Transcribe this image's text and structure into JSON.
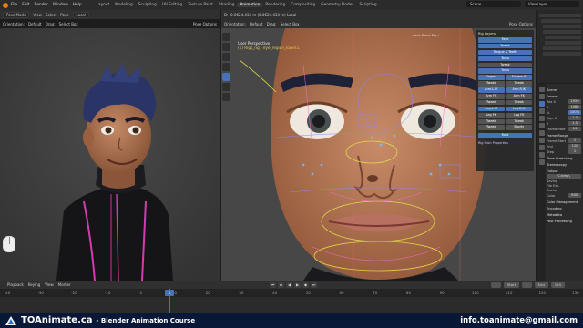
{
  "menu": {
    "items": [
      "File",
      "Edit",
      "Render",
      "Window",
      "Help"
    ],
    "workspaces": [
      "Layout",
      "Modeling",
      "Sculpting",
      "UV Editing",
      "Texture Paint",
      "Shading",
      "Animation",
      "Rendering",
      "Compositing",
      "Geometry Nodes",
      "Scripting"
    ],
    "active_workspace": "Animation",
    "scene_label": "Scene",
    "view_layer_label": "ViewLayer"
  },
  "left_header": {
    "mode": "Pose Mode",
    "view": "View",
    "select": "Select",
    "pose": "Pose",
    "transform": "Local",
    "orientation_label": "Orientation:",
    "orientation": "Default",
    "drag_label": "Drag:",
    "drag": "Select Box",
    "options": "Pose Options"
  },
  "right_header": {
    "info": "D: -0.0624.434 m (0.0624.434 m) Local",
    "orientation_label": "Orientation:",
    "orientation": "Default",
    "drag_label": "Drag:",
    "drag": "Select Box",
    "options": "Pose Options"
  },
  "viewport_overlay": {
    "line1": "User Perspective",
    "line2": "(1) Rigs_rig : eye_region_lower.L",
    "bone_label": "neck Plane.Rig.L"
  },
  "rig_panel": {
    "title": "Rig Layers",
    "buttons": [
      {
        "label": "Face",
        "on": true
      },
      {
        "label": "Tweak",
        "on": true
      },
      {
        "label": "Tongue & Teeth",
        "on": true
      },
      {
        "label": "Torso",
        "on": true
      },
      {
        "label": "Tweak",
        "on": false
      },
      {
        "label": "Torso",
        "on": true
      }
    ],
    "rows": [
      [
        {
          "label": "Fingers",
          "on": true
        },
        {
          "label": "Fingers R",
          "on": true
        }
      ],
      [
        {
          "label": "Tweak",
          "on": false
        },
        {
          "label": "Tweak",
          "on": false
        }
      ],
      [
        {
          "label": "Arm.L.IK",
          "on": true
        },
        {
          "label": "Arm.R.IK",
          "on": true
        }
      ],
      [
        {
          "label": "Arm FK",
          "on": false
        },
        {
          "label": "Arm FK",
          "on": false
        }
      ],
      [
        {
          "label": "Tweak",
          "on": false
        },
        {
          "label": "Tweak",
          "on": false
        }
      ],
      [
        {
          "label": "Leg.L.IK",
          "on": true
        },
        {
          "label": "Leg.R.IK",
          "on": true
        }
      ],
      [
        {
          "label": "Leg FK",
          "on": false
        },
        {
          "label": "Leg FK",
          "on": false
        }
      ],
      [
        {
          "label": "Tweak",
          "on": false
        },
        {
          "label": "Tweak",
          "on": false
        }
      ],
      [
        {
          "label": "Tweak",
          "on": false
        },
        {
          "label": "Shorty",
          "on": false
        }
      ]
    ],
    "root": "Root",
    "main_props": "Rig Main Properties"
  },
  "props": {
    "scene_label": "Scene",
    "format_label": "Format",
    "rows": [
      {
        "k": "Res X",
        "v": "1920"
      },
      {
        "k": "Y",
        "v": "1080"
      },
      {
        "k": "%",
        "v": "100%"
      },
      {
        "k": "Asp. X",
        "v": "1.0"
      },
      {
        "k": "Y",
        "v": "1.0"
      },
      {
        "k": "Frame Rate",
        "v": "24"
      }
    ],
    "range_label": "Frame Range",
    "range_rows": [
      {
        "k": "Frame Start",
        "v": "1"
      },
      {
        "k": "End",
        "v": "120"
      },
      {
        "k": "Step",
        "v": "1"
      }
    ],
    "time_stretching": "Time Stretching",
    "stereoscopy": "Stereoscopy",
    "output_label": "Output",
    "output_path": "C:\\tmp\\",
    "checks": [
      "Saving",
      "File Ext.",
      "Cache"
    ],
    "color_label": "Color",
    "color_value": "RGB",
    "color_mgmt": "Color Management",
    "encoding": "Encoding",
    "metadata": "Metadata",
    "post_processing": "Post Processing"
  },
  "timeline": {
    "menu": [
      "Playback",
      "Keying",
      "View",
      "Marker"
    ],
    "current_frame": "1",
    "start": "1",
    "end": "120",
    "start_label": "Start",
    "end_label": "End",
    "ticks": [
      "-40",
      "-30",
      "-20",
      "-10",
      "0",
      "10",
      "20",
      "30",
      "40",
      "50",
      "60",
      "70",
      "80",
      "90",
      "100",
      "110",
      "120",
      "130"
    ]
  },
  "banner": {
    "brand": "TOAnimate.ca",
    "course": "- Blender Animation Course",
    "email": "info.toanimate@gmail.com"
  },
  "colors": {
    "accent": "#4772b3",
    "banner": "#0a1838",
    "viewport": "#474747"
  }
}
